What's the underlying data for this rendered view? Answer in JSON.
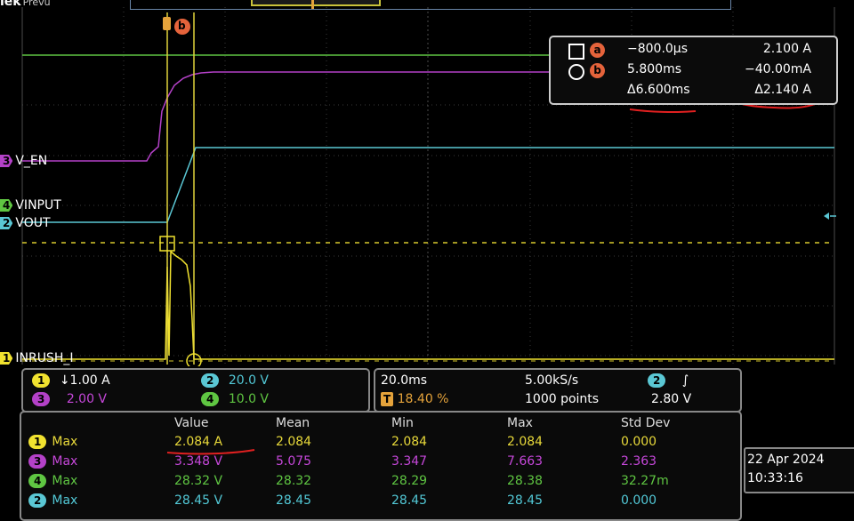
{
  "brand": {
    "name": "lek",
    "mode": "Prevu"
  },
  "channels": {
    "ch3": {
      "num": "3",
      "name": "V_EN",
      "color": "#b441c8"
    },
    "ch4": {
      "num": "4",
      "name": "VINPUT",
      "color": "#5fc642"
    },
    "ch2": {
      "num": "2",
      "name": "VOUT",
      "color": "#5ac7d4"
    },
    "ch1": {
      "num": "1",
      "name": "INRUSH_I",
      "color": "#f1e22f"
    }
  },
  "cursors": {
    "a": {
      "badge": "a",
      "time": "−800.0µs",
      "value": "2.100 A"
    },
    "b": {
      "badge": "b",
      "time": "5.800ms",
      "value": "−40.00mA"
    },
    "delta": {
      "time": "Δ6.600ms",
      "value": "Δ2.140 A"
    },
    "top_marker": "b"
  },
  "vertical": [
    {
      "ch": "1",
      "scale": "↓1.00 A",
      "color": "#f1e22f"
    },
    {
      "ch": "2",
      "scale": "20.0 V",
      "color": "#5ac7d4"
    },
    {
      "ch": "3",
      "scale": "2.00 V",
      "color": "#b441c8"
    },
    {
      "ch": "4",
      "scale": "10.0 V",
      "color": "#5fc642"
    }
  ],
  "horizontal": {
    "time_div": "20.0ms",
    "sample_rate": "5.00kS/s",
    "trigger_icon": "T",
    "trigger_pos": "18.40 %",
    "record": "1000 points",
    "trig_ch": "2",
    "trig_slope": "∫",
    "trig_level": "2.80 V"
  },
  "measurements": {
    "headers": [
      "Value",
      "Mean",
      "Min",
      "Max",
      "Std Dev"
    ],
    "rows": [
      {
        "ch": "1",
        "type": "Max",
        "color": "#e8d93a",
        "values": [
          "2.084 A",
          "2.084",
          "2.084",
          "2.084",
          "0.000"
        ]
      },
      {
        "ch": "3",
        "type": "Max",
        "color": "#c547d9",
        "values": [
          "3.348 V",
          "5.075",
          "3.347",
          "7.663",
          "2.363"
        ]
      },
      {
        "ch": "4",
        "type": "Max",
        "color": "#5fc642",
        "values": [
          "28.32 V",
          "28.32",
          "28.29",
          "28.38",
          "32.27m"
        ]
      },
      {
        "ch": "2",
        "type": "Max",
        "color": "#52c8d6",
        "values": [
          "28.45 V",
          "28.45",
          "28.45",
          "28.45",
          "0.000"
        ]
      }
    ]
  },
  "clock": {
    "date": "22 Apr  2024",
    "time": "10:33:16"
  }
}
